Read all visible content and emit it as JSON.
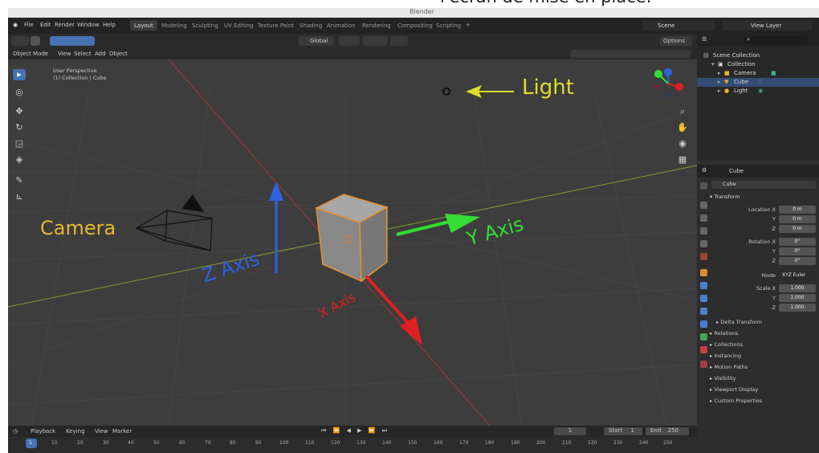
{
  "caption_text": "l'écran de mise en place.",
  "window_title": "Blender",
  "top_menu": [
    "File",
    "Edit",
    "Render",
    "Window",
    "Help"
  ],
  "workspace_tabs": [
    "Layout",
    "Modeling",
    "Sculpting",
    "UV Editing",
    "Texture Paint",
    "Shading",
    "Animation",
    "Rendering",
    "Compositing",
    "Scripting"
  ],
  "top_right": {
    "scene": "Scene",
    "view_layer": "View Layer"
  },
  "viewport_header": {
    "transform_orientation": "Global",
    "options": "Options"
  },
  "viewport_menu": {
    "mode": "Object Mode",
    "items": [
      "View",
      "Select",
      "Add",
      "Object"
    ]
  },
  "viewport_info": {
    "line1": "User Perspective",
    "line2": "(1) Collection | Cube"
  },
  "annotations": {
    "light": "Light",
    "camera": "Camera",
    "z_axis": "Z Axis",
    "y_axis": "Y Axis",
    "x_axis": "X Axis"
  },
  "outliner": {
    "rows": [
      {
        "label": "Scene Collection"
      },
      {
        "label": "Collection"
      },
      {
        "label": "Camera"
      },
      {
        "label": "Cube"
      },
      {
        "label": "Light"
      }
    ]
  },
  "properties": {
    "object_name": "Cube",
    "object_field": "Cube",
    "transform_label": "Transform",
    "location": {
      "label_x": "Location X",
      "y": "Y",
      "z": "Z",
      "values": [
        "0 m",
        "0 m",
        "0 m"
      ]
    },
    "rotation": {
      "label_x": "Rotation X",
      "y": "Y",
      "z": "Z",
      "values": [
        "0°",
        "0°",
        "0°"
      ]
    },
    "mode": {
      "label": "Mode",
      "value": "XYZ Euler"
    },
    "scale": {
      "label_x": "Scale X",
      "y": "Y",
      "z": "Z",
      "values": [
        "1.000",
        "1.000",
        "1.000"
      ]
    },
    "panels": [
      "Delta Transform",
      "Relations",
      "Collections",
      "Instancing",
      "Motion Paths",
      "Visibility",
      "Viewport Display",
      "Custom Properties"
    ]
  },
  "timeline": {
    "menu": [
      "Playback",
      "Keying",
      "View",
      "Marker"
    ],
    "current_frame": "1",
    "start_label": "Start",
    "start": "1",
    "end_label": "End",
    "end": "250",
    "ticks": [
      "1",
      "10",
      "20",
      "30",
      "40",
      "50",
      "60",
      "70",
      "80",
      "90",
      "100",
      "110",
      "120",
      "130",
      "140",
      "150",
      "160",
      "170",
      "180",
      "190",
      "200",
      "210",
      "220",
      "230",
      "240",
      "250"
    ]
  },
  "colors": {
    "accent": "#4772b3",
    "x_axis": "#e02020",
    "y_axis": "#33dd33",
    "z_axis": "#2e62e0",
    "light_label": "#dede2a",
    "camera_label": "#e6b830"
  }
}
